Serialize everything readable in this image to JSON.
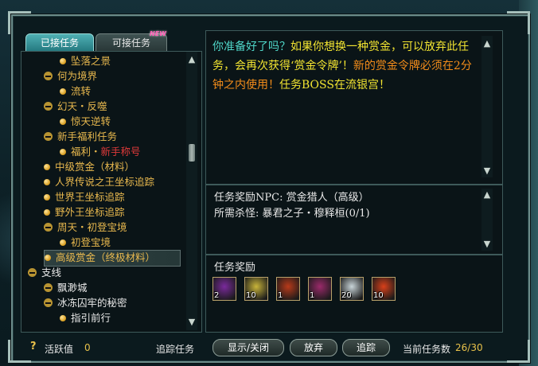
{
  "tabs": {
    "active": "已接任务",
    "inactive": "可接任务",
    "new_badge": "NEW"
  },
  "tree": [
    {
      "text": "坠落之景",
      "level": 2,
      "icon": "bullet"
    },
    {
      "text": "何为境界",
      "level": 1,
      "icon": "minus"
    },
    {
      "text": "流转",
      "level": 2,
      "icon": "bullet"
    },
    {
      "text": "幻天・反噬",
      "level": 1,
      "icon": "minus"
    },
    {
      "text": "惊天逆转",
      "level": 2,
      "icon": "bullet"
    },
    {
      "text": "新手福利任务",
      "level": 1,
      "icon": "minus"
    },
    {
      "text": "福利・",
      "text_red": "新手称号",
      "level": 2,
      "icon": "bullet"
    },
    {
      "text": "中级赏金（材料）",
      "level": 1,
      "icon": "bullet"
    },
    {
      "text": "人界传说之王坐标追踪",
      "level": 1,
      "icon": "bullet"
    },
    {
      "text": "世界王坐标追踪",
      "level": 1,
      "icon": "bullet"
    },
    {
      "text": "野外王坐标追踪",
      "level": 1,
      "icon": "bullet"
    },
    {
      "text": "周天・初登宝境",
      "level": 1,
      "icon": "minus"
    },
    {
      "text": "初登宝境",
      "level": 2,
      "icon": "bullet"
    },
    {
      "text": "高级赏金（终极材料）",
      "level": 1,
      "icon": "bullet",
      "selected": true
    },
    {
      "text": "支线",
      "level": 0,
      "icon": "minus",
      "white": true
    },
    {
      "text": "飘渺城",
      "level": 1,
      "icon": "minus",
      "white": true
    },
    {
      "text": "冰冻囚牢的秘密",
      "level": 1,
      "icon": "minus",
      "white": true
    },
    {
      "text": "指引前行",
      "level": 2,
      "icon": "bullet",
      "white": true
    }
  ],
  "description": {
    "part1": "你准备好了吗？",
    "part2": "如果你想换一种赏金，可以放弃此任务，会再次获得‘赏金令牌’！",
    "part3": "新的赏金令牌必须在2分钟之内使用！",
    "part4": "任务BOSS在流银宫！"
  },
  "info": {
    "npc_line": "任务奖励NPC: 赏金猎人（高级）",
    "kill_line": "所需杀怪: 暴君之子・穆释桓(0/1)"
  },
  "rewards": {
    "title": "任务奖励",
    "items": [
      {
        "icon": "purple-potion-icon",
        "count": "2",
        "color": "#7a2a9c"
      },
      {
        "icon": "gold-stone-icon",
        "count": "10",
        "color": "#c8b43a"
      },
      {
        "icon": "red-chest-icon",
        "count": "1",
        "color": "#b83a1a"
      },
      {
        "icon": "purple-gem-icon",
        "count": "1",
        "color": "#9a2a6a"
      },
      {
        "icon": "white-scroll-icon",
        "count": "20",
        "color": "#c8d4d8"
      },
      {
        "icon": "red-orb-icon",
        "count": "10",
        "color": "#d8401a"
      }
    ]
  },
  "bottom": {
    "help_icon": "?",
    "activity_label": "活跃值",
    "activity_value": "0",
    "track_label": "追踪任务",
    "btn_toggle": "显示/关闭",
    "btn_abandon": "放弃",
    "btn_track": "追踪",
    "current_label": "当前任务数",
    "current_value": "26/30"
  }
}
